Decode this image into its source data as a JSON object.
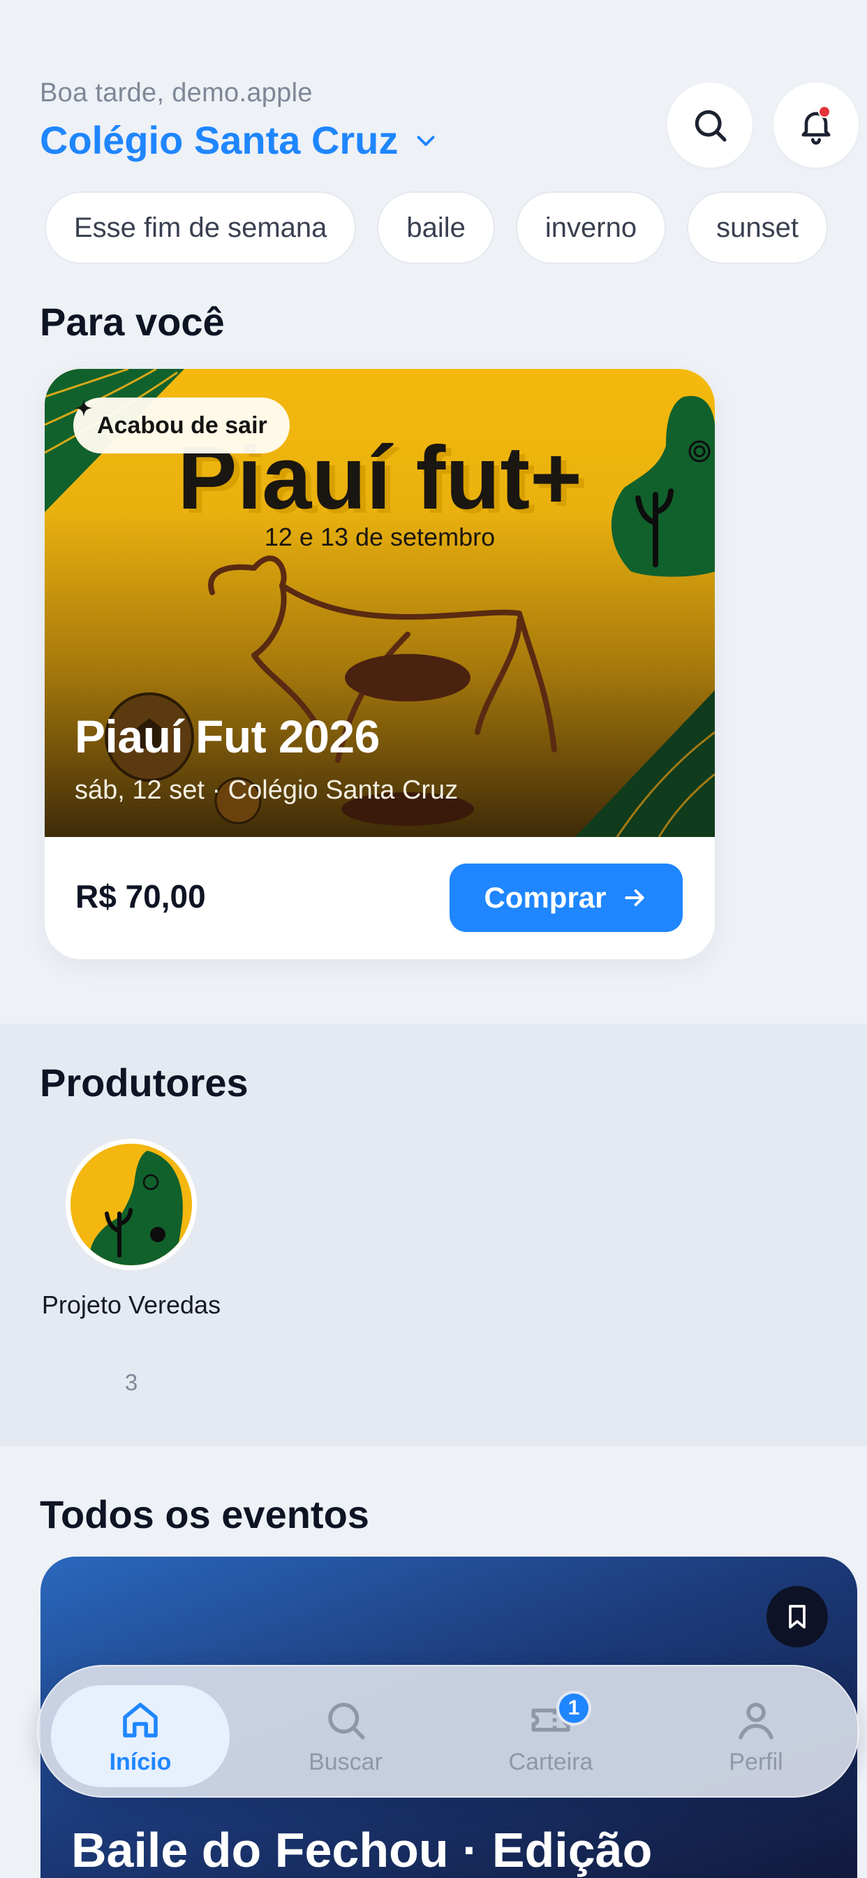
{
  "header": {
    "greeting": "Boa tarde, demo.apple",
    "school": "Colégio Santa Cruz"
  },
  "chips": [
    "Esse fim de semana",
    "baile",
    "inverno",
    "sunset"
  ],
  "for_you": {
    "section_title": "Para você",
    "card": {
      "badge": "Acabou de sair",
      "poster_title": "Piauí fut+",
      "poster_dates": "12 e 13 de setembro",
      "title": "Piauí Fut 2026",
      "meta": "sáb, 12 set · Colégio Santa Cruz",
      "price": "R$ 70,00",
      "buy_label": "Comprar"
    }
  },
  "producers": {
    "section_title": "Produtores",
    "items": [
      {
        "name": "Projeto Veredas",
        "count": "3"
      }
    ]
  },
  "all_events": {
    "section_title": "Todos os eventos",
    "first_event_title": "Baile do Fechou · Edição"
  },
  "tabbar": {
    "tabs": [
      {
        "label": "Início",
        "icon": "home-icon",
        "active": true
      },
      {
        "label": "Buscar",
        "icon": "search-icon",
        "active": false
      },
      {
        "label": "Carteira",
        "icon": "ticket-icon",
        "active": false,
        "badge": "1"
      },
      {
        "label": "Perfil",
        "icon": "user-icon",
        "active": false
      }
    ]
  },
  "colors": {
    "accent": "#1f86ff",
    "background": "#eef1f6",
    "poster_yellow": "#f4b70f",
    "poster_green": "#11612c",
    "notification_dot": "#e5343b"
  }
}
